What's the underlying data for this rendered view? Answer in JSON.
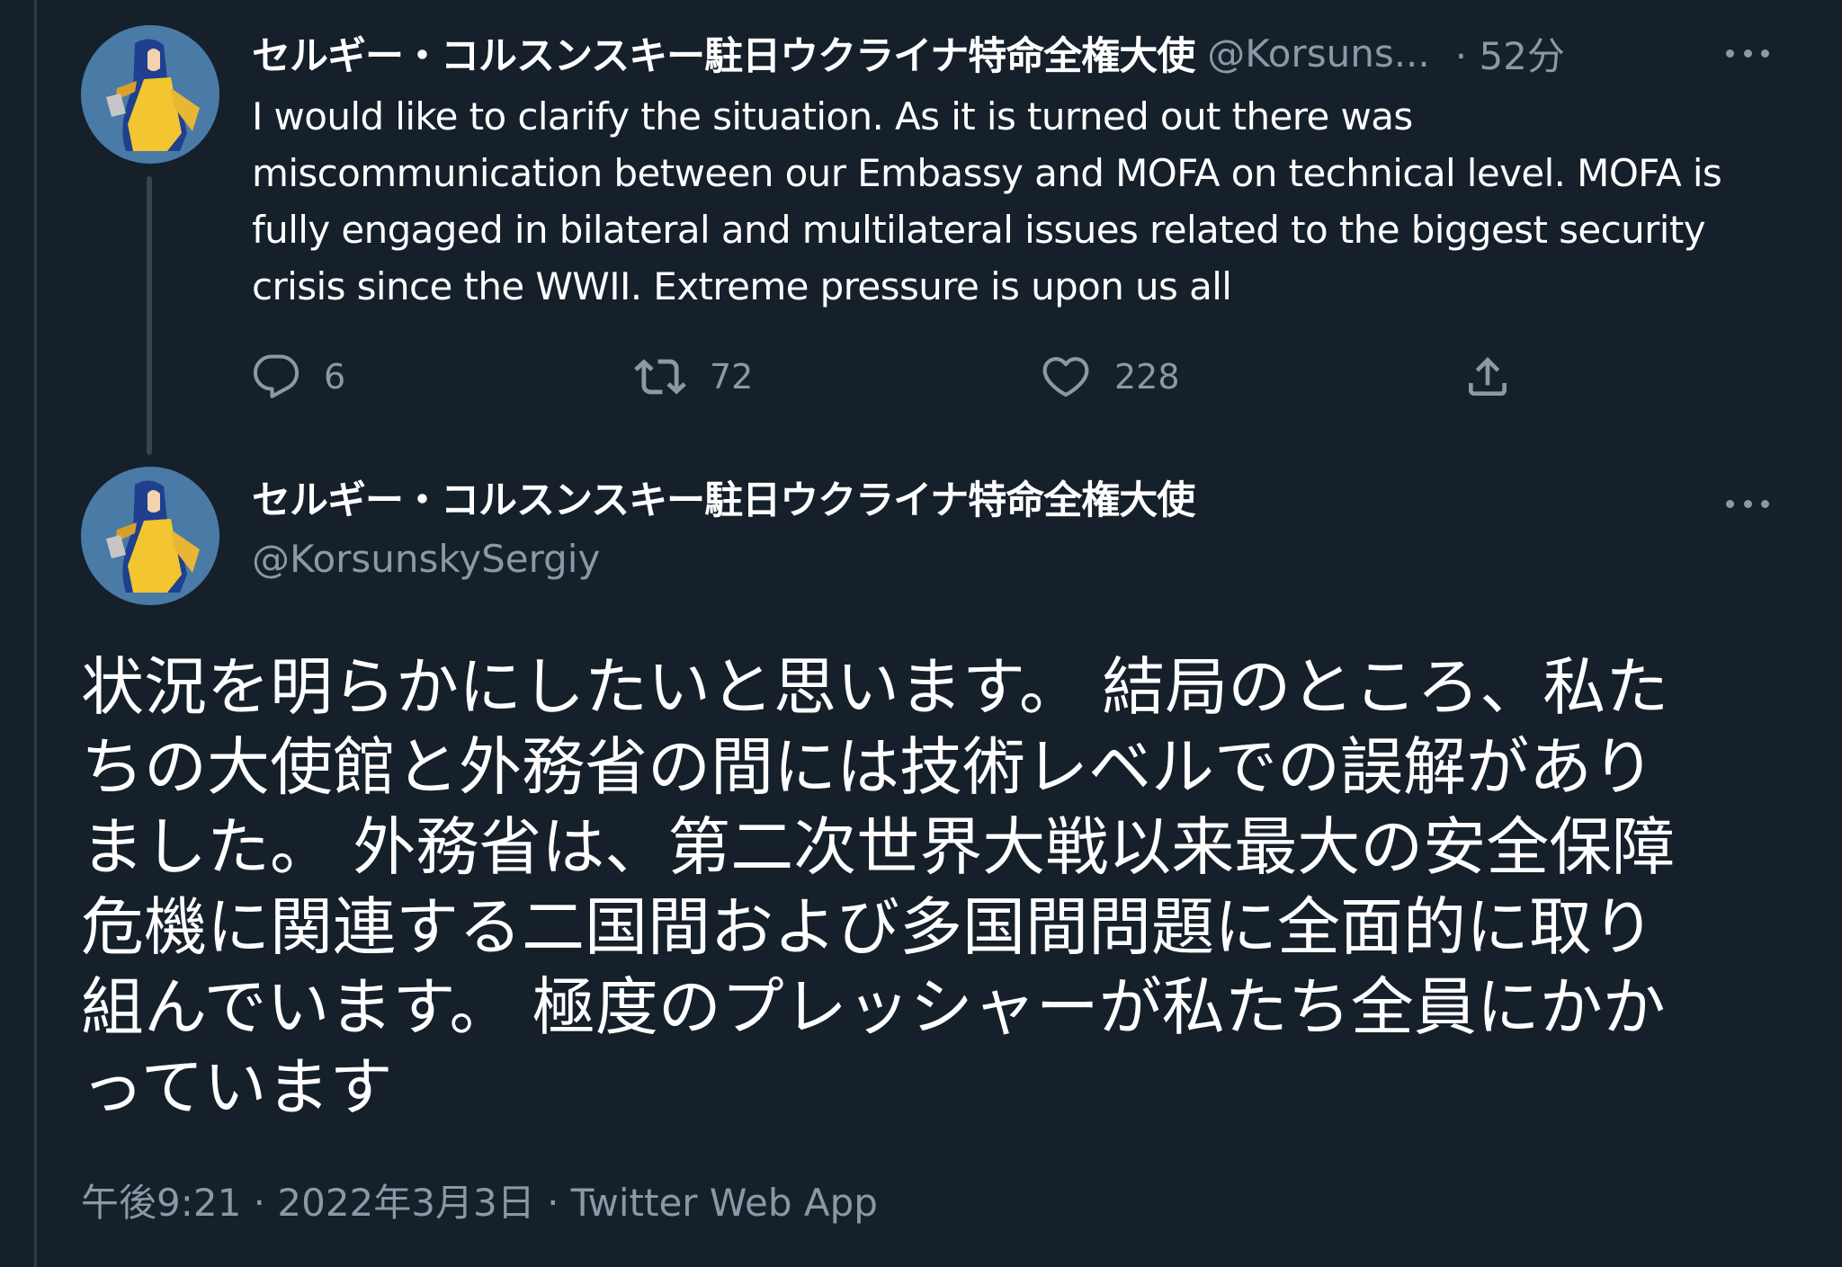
{
  "tweet1": {
    "display_name": "セルギー・コルスンスキー駐日ウクライナ特命全権大使",
    "handle": "@Korsuns...",
    "time": "· 52分",
    "text": "I would like to clarify the situation. As it is turned out there was\nmiscommunication between our Embassy and MOFA on technical level. MOFA is\nfully engaged in bilateral and multilateral issues related to the biggest security\ncrisis since the WWII. Extreme pressure is upon us all",
    "reply_count": "6",
    "retweet_count": "72",
    "like_count": "228",
    "icons": [
      "reply-icon",
      "retweet-icon",
      "like-icon",
      "share-icon",
      "more-icon"
    ]
  },
  "tweet2": {
    "display_name": "セルギー・コルスンスキー駐日ウクライナ特命全権大使",
    "handle": "@KorsunskySergiy",
    "text": "状況を明らかにしたいと思います。 結局のところ、私た\nちの大使館と外務省の間には技術レベルでの誤解があり\nました。 外務省は、第二次世界大戦以来最大の安全保障\n危機に関連する二国間および多国間問題に全面的に取り\n組んでいます。 極度のプレッシャーが私たち全員にかか\nっています",
    "time": "午後9:21",
    "separator1": " · ",
    "date": "2022年3月3日",
    "separator2": " · ",
    "source": "Twitter Web App"
  },
  "colors": {
    "background": "#15202b",
    "text_primary": "#ffffff",
    "text_secondary": "#8b98a5",
    "thread_line": "#38444d"
  }
}
